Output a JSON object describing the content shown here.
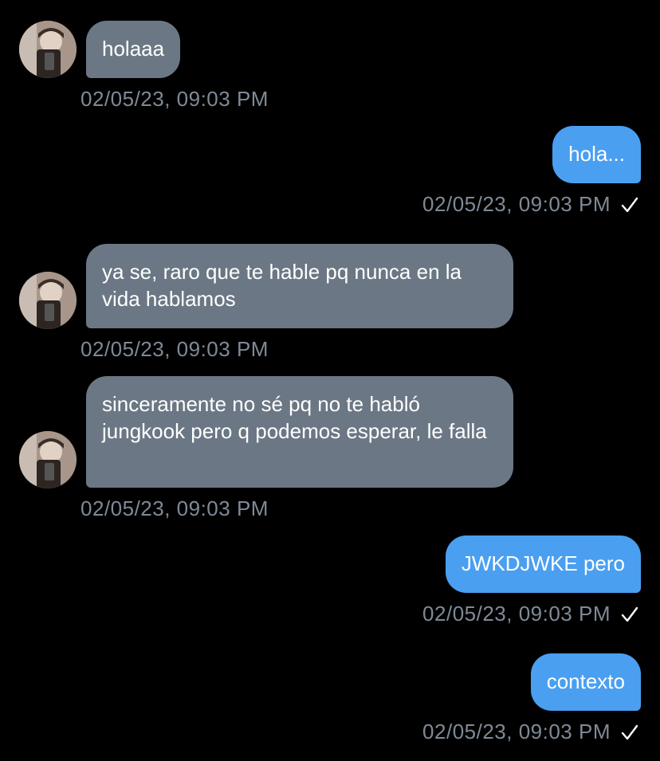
{
  "messages": [
    {
      "direction": "incoming",
      "text": "holaaa",
      "timestamp": "02/05/23, 09:03 PM"
    },
    {
      "direction": "outgoing",
      "text": "hola...",
      "timestamp": "02/05/23, 09:03 PM",
      "status_icon": "check-icon"
    },
    {
      "direction": "incoming",
      "text": "ya se, raro que te hable pq nunca en la vida hablamos",
      "timestamp": "02/05/23, 09:03 PM"
    },
    {
      "direction": "incoming",
      "text": "sinceramente no sé pq no te habló jungkook pero q podemos esperar, le falla",
      "timestamp": "02/05/23, 09:03 PM"
    },
    {
      "direction": "outgoing",
      "text": "JWKDJWKE pero",
      "timestamp": "02/05/23, 09:03 PM",
      "status_icon": "check-icon"
    },
    {
      "direction": "outgoing",
      "text": "contexto",
      "timestamp": "02/05/23, 09:03 PM",
      "status_icon": "check-icon"
    }
  ],
  "colors": {
    "background": "#000000",
    "incoming_bubble": "#6b7784",
    "outgoing_bubble": "#4a9ff0",
    "timestamp": "#7f8a96",
    "text": "#ffffff"
  }
}
